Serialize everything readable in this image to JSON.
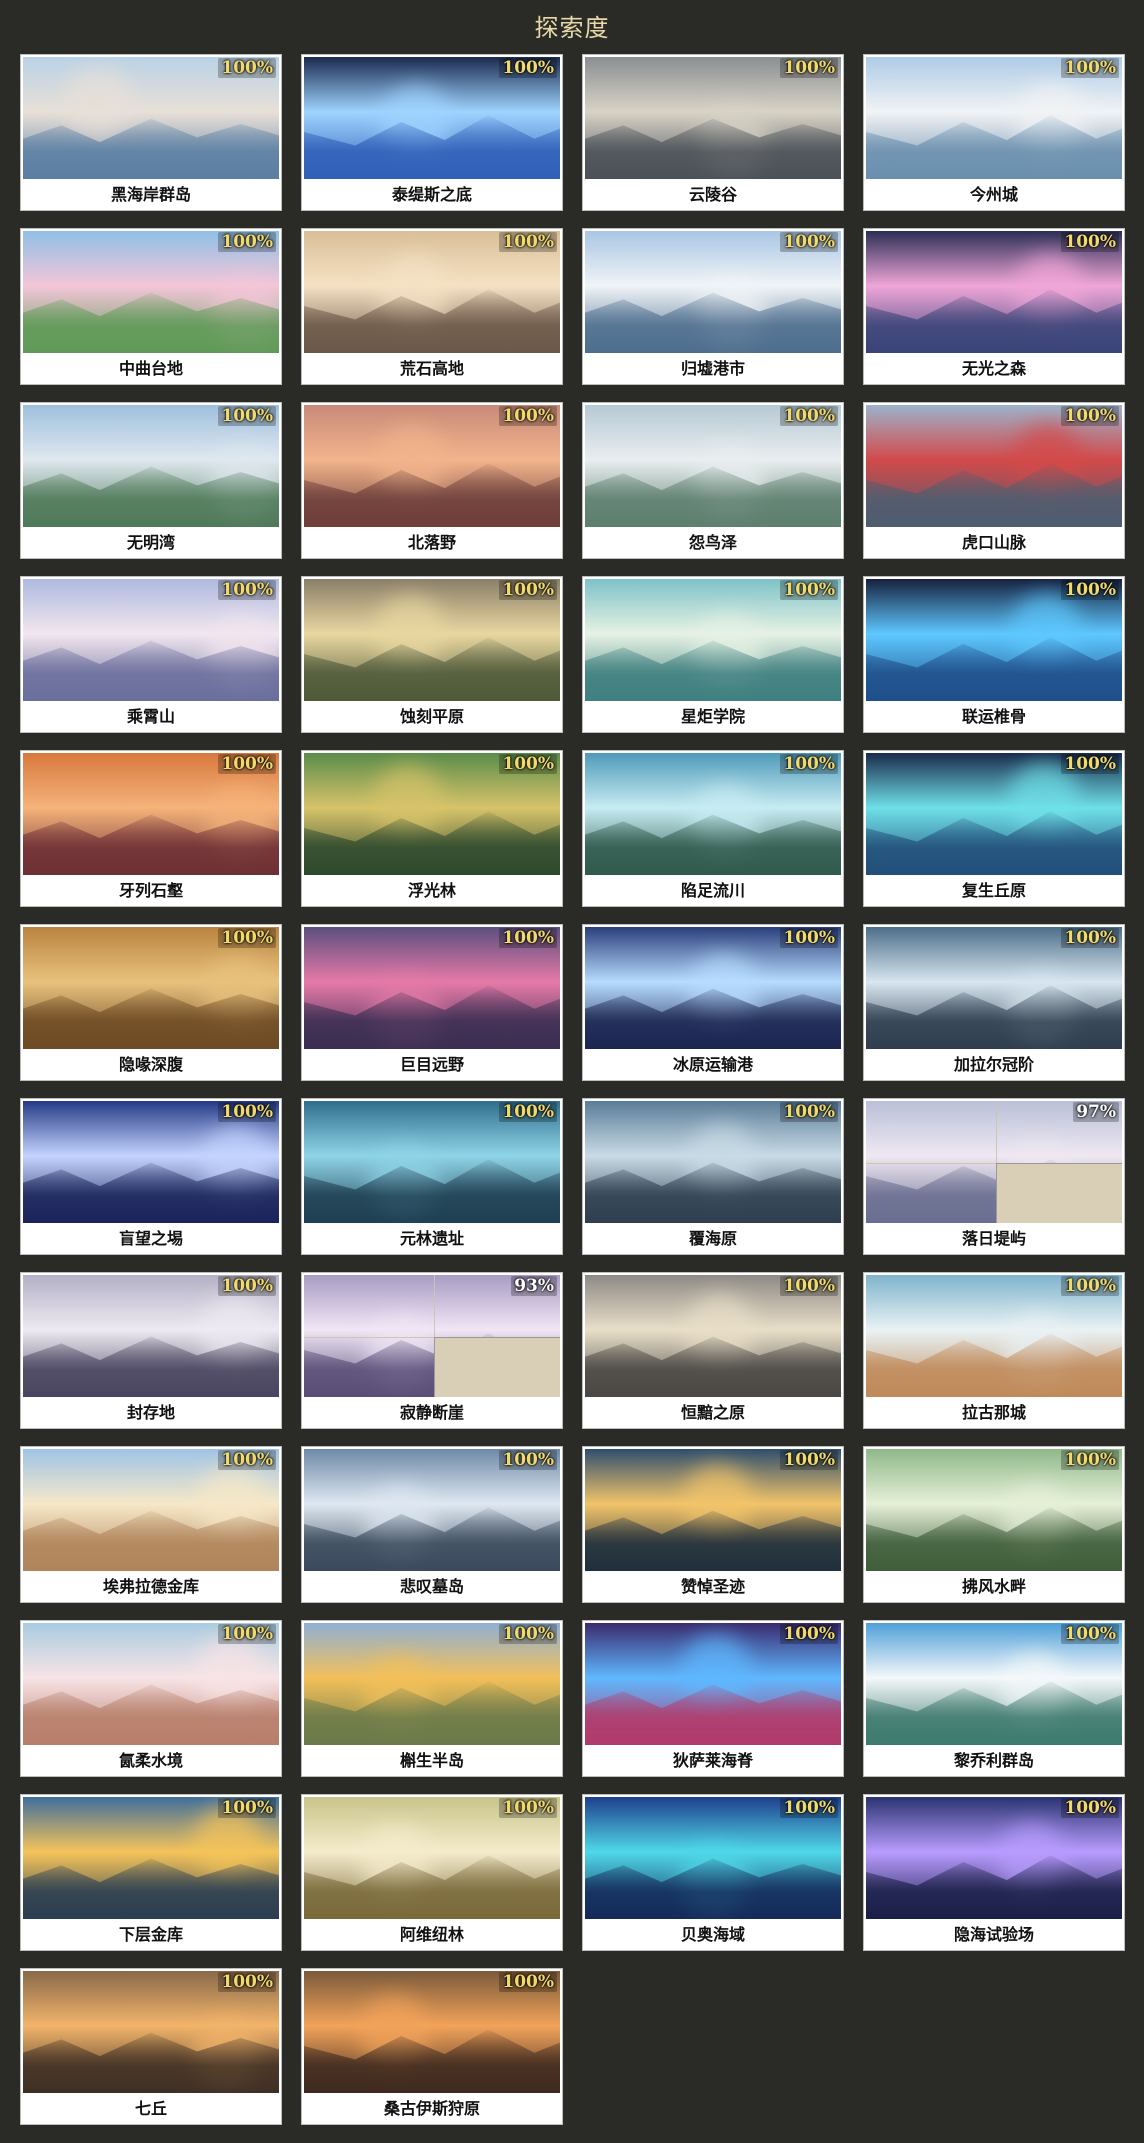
{
  "page": {
    "title": "探索度"
  },
  "regions": [
    {
      "name": "黑海岸群岛",
      "progress": "100%",
      "colors": [
        "#b9d2e6",
        "#5b7fa3",
        "#e8e0d8"
      ]
    },
    {
      "name": "泰缇斯之底",
      "progress": "100%",
      "colors": [
        "#1b2a4f",
        "#2f5fb8",
        "#9fd4ff"
      ]
    },
    {
      "name": "云陵谷",
      "progress": "100%",
      "colors": [
        "#8a8f92",
        "#4b5158",
        "#d8d3c6"
      ]
    },
    {
      "name": "今州城",
      "progress": "100%",
      "colors": [
        "#aecbe6",
        "#6a8fae",
        "#f1f3f5"
      ]
    },
    {
      "name": "中曲台地",
      "progress": "100%",
      "colors": [
        "#8fc0e6",
        "#5f9a57",
        "#f3c6d8"
      ]
    },
    {
      "name": "荒石高地",
      "progress": "100%",
      "colors": [
        "#d9bf98",
        "#6c5848",
        "#f5e2c4"
      ]
    },
    {
      "name": "归墟港市",
      "progress": "100%",
      "colors": [
        "#a9c6e4",
        "#4e6e8e",
        "#f0f4f7"
      ]
    },
    {
      "name": "无光之森",
      "progress": "100%",
      "colors": [
        "#2b2f55",
        "#3a4478",
        "#f0a6d8"
      ]
    },
    {
      "name": "无明湾",
      "progress": "100%",
      "colors": [
        "#9ec0de",
        "#4f7a59",
        "#dfe8ef"
      ]
    },
    {
      "name": "北落野",
      "progress": "100%",
      "colors": [
        "#c88a78",
        "#6d3e3a",
        "#f2b48c"
      ]
    },
    {
      "name": "怨鸟泽",
      "progress": "100%",
      "colors": [
        "#b6c9d4",
        "#5d7f6e",
        "#e9eef0"
      ]
    },
    {
      "name": "虎口山脉",
      "progress": "100%",
      "colors": [
        "#9cb3cc",
        "#4e5d6f",
        "#d24a4a"
      ]
    },
    {
      "name": "乘霄山",
      "progress": "100%",
      "colors": [
        "#aebadf",
        "#6a6e9c",
        "#f2e6ef"
      ]
    },
    {
      "name": "蚀刻平原",
      "progress": "100%",
      "colors": [
        "#8a7f69",
        "#4f5a3a",
        "#e9d7a0"
      ]
    },
    {
      "name": "星炬学院",
      "progress": "100%",
      "colors": [
        "#7ec2c8",
        "#3e7f7f",
        "#e6f2e4"
      ]
    },
    {
      "name": "联运椎骨",
      "progress": "100%",
      "colors": [
        "#16213e",
        "#1f4f8a",
        "#5ec8ff"
      ]
    },
    {
      "name": "牙列石壑",
      "progress": "100%",
      "colors": [
        "#d9793f",
        "#6e2f35",
        "#f5b37a"
      ]
    },
    {
      "name": "浮光林",
      "progress": "100%",
      "colors": [
        "#5b8c4a",
        "#2e4a2d",
        "#d7c36a"
      ]
    },
    {
      "name": "陷足流川",
      "progress": "100%",
      "colors": [
        "#4f9ab8",
        "#2f5a4c",
        "#c7ecf3"
      ]
    },
    {
      "name": "复生丘原",
      "progress": "100%",
      "colors": [
        "#1a2a4c",
        "#224f7a",
        "#6fe0e8"
      ]
    },
    {
      "name": "隐喙深腹",
      "progress": "100%",
      "colors": [
        "#b9843f",
        "#6e4a24",
        "#e8c27d"
      ]
    },
    {
      "name": "巨目远野",
      "progress": "100%",
      "colors": [
        "#5b4f7e",
        "#3a2e52",
        "#e57aa8"
      ]
    },
    {
      "name": "冰原运输港",
      "progress": "100%",
      "colors": [
        "#2a3f7a",
        "#1a2550",
        "#b7dcff"
      ]
    },
    {
      "name": "加拉尔冠阶",
      "progress": "100%",
      "colors": [
        "#4c6e88",
        "#2f3e4f",
        "#d7e6f0"
      ]
    },
    {
      "name": "盲望之埸",
      "progress": "100%",
      "colors": [
        "#243a86",
        "#1a245a",
        "#c5d4ff"
      ]
    },
    {
      "name": "元林遗址",
      "progress": "100%",
      "colors": [
        "#2f6e8c",
        "#1f3f52",
        "#8fd4e8"
      ]
    },
    {
      "name": "覆海原",
      "progress": "100%",
      "colors": [
        "#5a7c98",
        "#2e3f50",
        "#c9dbe6"
      ]
    },
    {
      "name": "落日堤屿",
      "progress": "97%",
      "colors": [
        "#b9c0d8",
        "#6a6e90",
        "#efe8f2"
      ]
    },
    {
      "name": "封存地",
      "progress": "100%",
      "colors": [
        "#b4b0c6",
        "#4a4560",
        "#eeeaf2"
      ]
    },
    {
      "name": "寂静断崖",
      "progress": "93%",
      "colors": [
        "#a99cc4",
        "#5a4e78",
        "#f0e6f5"
      ]
    },
    {
      "name": "恒黯之原",
      "progress": "100%",
      "colors": [
        "#8d8a86",
        "#4a4744",
        "#e9dfc8"
      ]
    },
    {
      "name": "拉古那城",
      "progress": "100%",
      "colors": [
        "#7fb4cc",
        "#c08a5a",
        "#e9f2f4"
      ]
    },
    {
      "name": "埃弗拉德金库",
      "progress": "100%",
      "colors": [
        "#9fc4e6",
        "#b0845a",
        "#f6e8c8"
      ]
    },
    {
      "name": "悲叹墓岛",
      "progress": "100%",
      "colors": [
        "#6e8aa8",
        "#3a4a5c",
        "#dfe8f2"
      ]
    },
    {
      "name": "赞悼圣迹",
      "progress": "100%",
      "colors": [
        "#2f4f6e",
        "#1f2f3c",
        "#f2c46a"
      ]
    },
    {
      "name": "拂风水畔",
      "progress": "100%",
      "colors": [
        "#8fb88a",
        "#3f5e3a",
        "#e6f0d8"
      ]
    },
    {
      "name": "氤柔水境",
      "progress": "100%",
      "colors": [
        "#a8cce0",
        "#b77e6a",
        "#f8e4e6"
      ]
    },
    {
      "name": "槲生半岛",
      "progress": "100%",
      "colors": [
        "#8fb0d4",
        "#6a7a4a",
        "#f2c05a"
      ]
    },
    {
      "name": "狄萨莱海脊",
      "progress": "100%",
      "colors": [
        "#3a2a6e",
        "#b23a6a",
        "#5fb8ff"
      ]
    },
    {
      "name": "黎乔利群岛",
      "progress": "100%",
      "colors": [
        "#4fa0d8",
        "#3e7a6e",
        "#f4f8fa"
      ]
    },
    {
      "name": "下层金库",
      "progress": "100%",
      "colors": [
        "#3f6e9c",
        "#2a3e52",
        "#f5c45a"
      ]
    },
    {
      "name": "阿维纽林",
      "progress": "100%",
      "colors": [
        "#c8c48a",
        "#7a6a3a",
        "#f5eccc"
      ]
    },
    {
      "name": "贝奥海域",
      "progress": "100%",
      "colors": [
        "#1f3f8c",
        "#142a5a",
        "#4fd8e8"
      ]
    },
    {
      "name": "隐海试验场",
      "progress": "100%",
      "colors": [
        "#2a3470",
        "#1a1f48",
        "#b89cff"
      ]
    },
    {
      "name": "七丘",
      "progress": "100%",
      "colors": [
        "#8a6a4a",
        "#3f2f24",
        "#f2b46a"
      ]
    },
    {
      "name": "桑古伊斯狩原",
      "progress": "100%",
      "colors": [
        "#7a5a3a",
        "#3f2a1f",
        "#f2a35a"
      ]
    }
  ]
}
